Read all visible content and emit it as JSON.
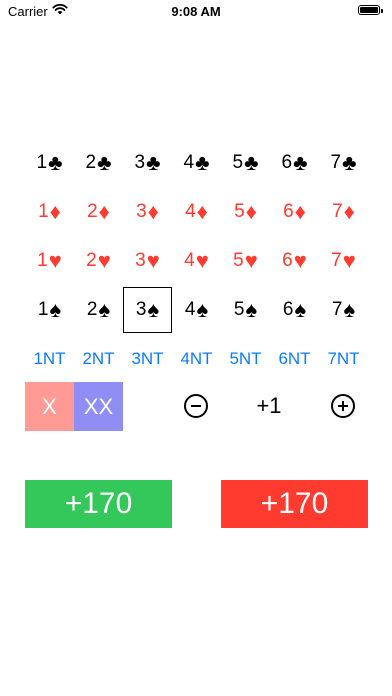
{
  "status_bar": {
    "carrier": "Carrier",
    "time": "9:08 AM"
  },
  "grid": {
    "selected": "3♠",
    "rows": [
      {
        "suit": "clubs",
        "suit_glyph": "♣",
        "color": "#000000",
        "cells": [
          "1",
          "2",
          "3",
          "4",
          "5",
          "6",
          "7"
        ]
      },
      {
        "suit": "diamonds",
        "suit_glyph": "♦",
        "color": "#ff3b30",
        "cells": [
          "1",
          "2",
          "3",
          "4",
          "5",
          "6",
          "7"
        ]
      },
      {
        "suit": "hearts",
        "suit_glyph": "♥",
        "color": "#ff3b30",
        "cells": [
          "1",
          "2",
          "3",
          "4",
          "5",
          "6",
          "7"
        ]
      },
      {
        "suit": "spades",
        "suit_glyph": "♠",
        "color": "#000000",
        "cells": [
          "1",
          "2",
          "3",
          "4",
          "5",
          "6",
          "7"
        ]
      }
    ],
    "notrump": [
      "1NT",
      "2NT",
      "3NT",
      "4NT",
      "5NT",
      "6NT",
      "7NT"
    ]
  },
  "controls": {
    "double_label": "X",
    "redouble_label": "XX",
    "overtricks": "+1"
  },
  "scores": {
    "left": "+170",
    "right": "+170"
  },
  "colors": {
    "green": "#34c759",
    "red": "#ff3b30",
    "blue": "#0a7bff",
    "double": "#ff9a95",
    "redouble": "#8f8ef4"
  }
}
